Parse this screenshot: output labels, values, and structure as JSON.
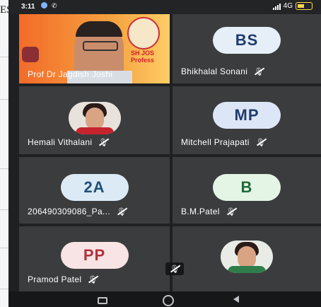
{
  "left_strip_text": "ES",
  "status": {
    "time": "3:11",
    "network": "4G",
    "battery": "55"
  },
  "tiles": {
    "speaker": {
      "name": "Prof Dr Jagdish Joshi",
      "banner_text": "SH JOS",
      "banner_sub": "Profess"
    },
    "t1": {
      "initials": "BS",
      "name": "Bhikhalal Sonani",
      "avatar_bg": "#e6eef7",
      "avatar_fg": "#1f3b6e"
    },
    "t2": {
      "name": "Hemali Vithalani"
    },
    "t3": {
      "initials": "MP",
      "name": "Mitchell Prajapati",
      "avatar_bg": "#dde6f6",
      "avatar_fg": "#1f3b6e"
    },
    "t4": {
      "initials": "2A",
      "name": "206490309086_Pa...",
      "avatar_bg": "#dceaf5",
      "avatar_fg": "#1f4f78"
    },
    "t5": {
      "initials": "B",
      "name": "B.M.Patel",
      "avatar_bg": "#e4f4e5",
      "avatar_fg": "#1f6a3a"
    },
    "t6": {
      "initials": "PP",
      "name": "Pramod Patel",
      "avatar_bg": "#f8e4e4",
      "avatar_fg": "#b0323a"
    },
    "t7": {
      "name": ""
    }
  },
  "icons": [
    "muted-mic-icon",
    "home-icon",
    "back-icon",
    "recents-icon",
    "signal-icon",
    "battery-icon"
  ]
}
